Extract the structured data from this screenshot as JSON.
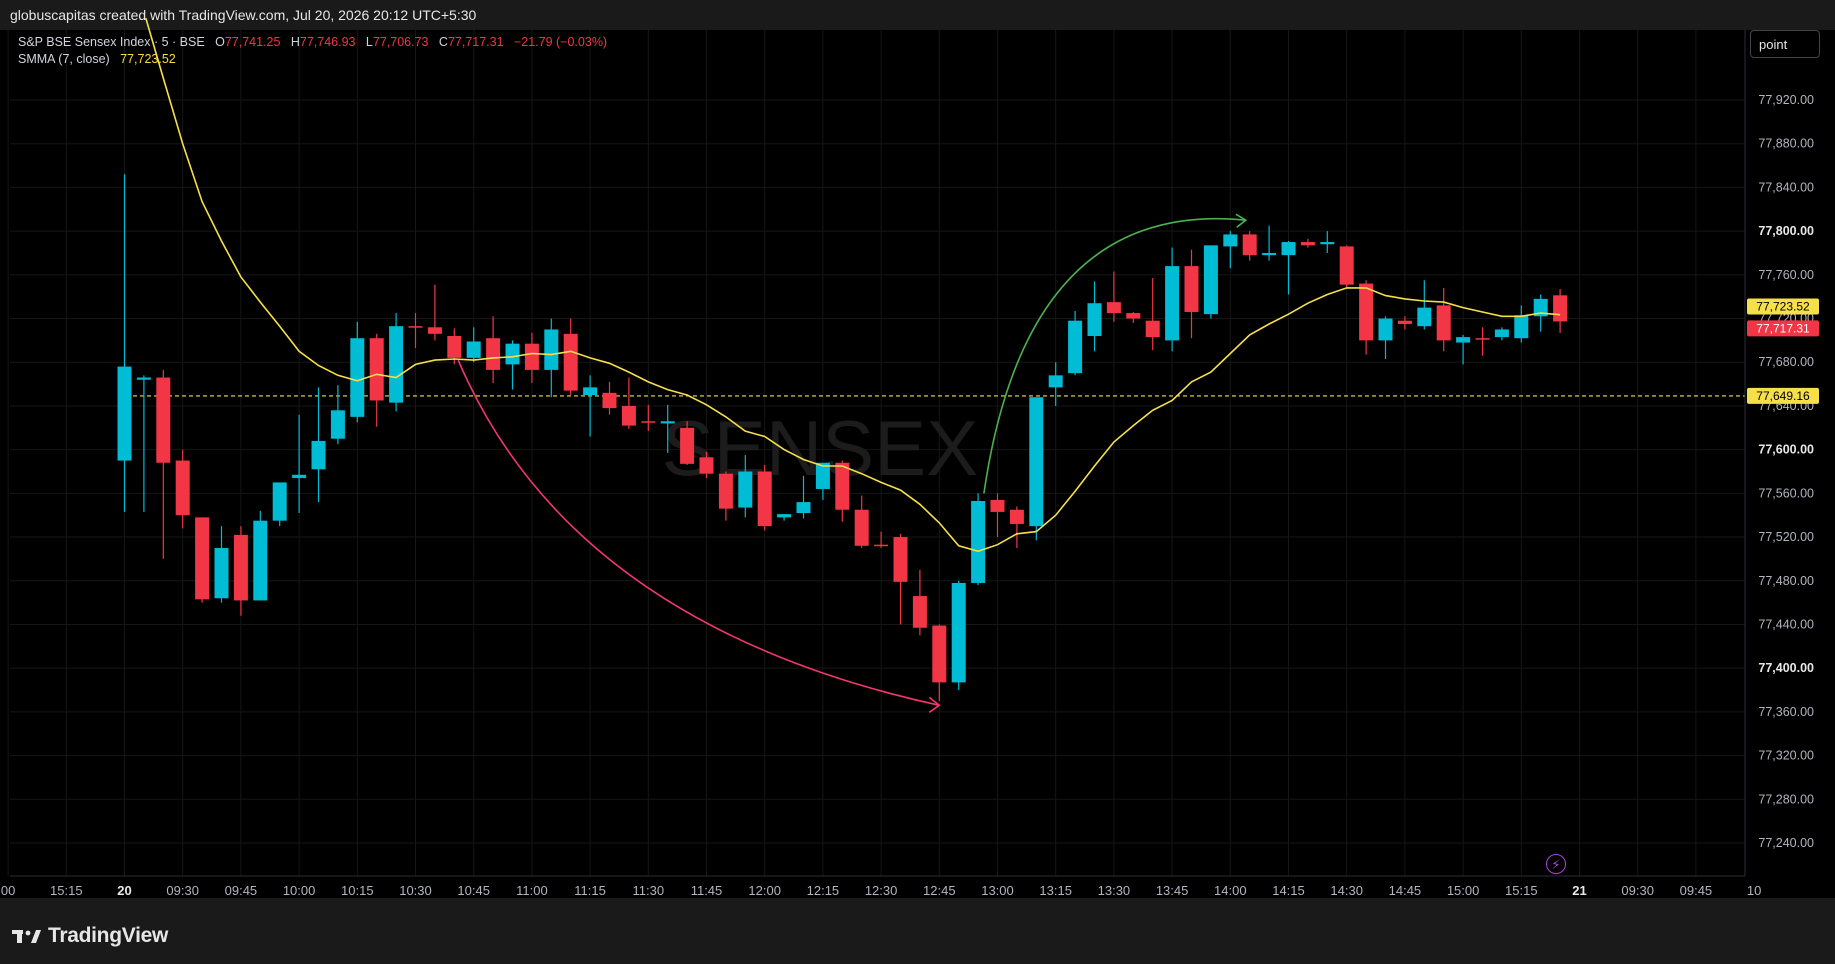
{
  "header": {
    "credit": "globuscapitas created with TradingView.com, Jul 20, 2026 20:12 UTC+5:30"
  },
  "legend": {
    "symbol": "S&P BSE Sensex Index · 5 · BSE",
    "o_label": "O",
    "o_value": "77,741.25",
    "h_label": "H",
    "h_value": "77,746.93",
    "l_label": "L",
    "l_value": "77,706.73",
    "c_label": "C",
    "c_value": "77,717.31",
    "change": "−21.79 (−0.03%)",
    "indicator": "SMMA (7, close)",
    "indicator_value": "77,723.52"
  },
  "toolbar": {
    "point_label": "point"
  },
  "watermark": "SENSEX",
  "brand": {
    "name": "TradingView"
  },
  "price_labels": {
    "smma": "77,723.52",
    "last": "77,717.31",
    "level": "77,649.16"
  },
  "colors": {
    "up": "#00bcd4",
    "down": "#f23645",
    "smma": "#f5e04a",
    "level": "#f5e04a",
    "arrow_down": "#f23670",
    "arrow_up": "#4caf50"
  },
  "chart_data": {
    "type": "candlestick",
    "interval": "5",
    "ylim": [
      77200,
      77960
    ],
    "y_ticks": [
      77240,
      77280,
      77320,
      77360,
      77400,
      77440,
      77480,
      77520,
      77560,
      77600,
      77640,
      77680,
      77720,
      77760,
      77800,
      77840,
      77880,
      77920
    ],
    "y_tick_labels": [
      "77,240.00",
      "77,280.00",
      "77,320.00",
      "77,360.00",
      "77,400.00",
      "77,440.00",
      "77,480.00",
      "77,520.00",
      "77,560.00",
      "77,600.00",
      "77,640.00",
      "77,680.00",
      "77,720.00",
      "77,760.00",
      "77,800.00",
      "77,840.00",
      "77,880.00",
      "77,920.00"
    ],
    "x_ticks": [
      {
        "slot": -6,
        "label": "00"
      },
      {
        "slot": -3,
        "label": "15:15"
      },
      {
        "slot": 0,
        "label": "20"
      },
      {
        "slot": 3,
        "label": "09:30"
      },
      {
        "slot": 6,
        "label": "09:45"
      },
      {
        "slot": 9,
        "label": "10:00"
      },
      {
        "slot": 12,
        "label": "10:15"
      },
      {
        "slot": 15,
        "label": "10:30"
      },
      {
        "slot": 18,
        "label": "10:45"
      },
      {
        "slot": 21,
        "label": "11:00"
      },
      {
        "slot": 24,
        "label": "11:15"
      },
      {
        "slot": 27,
        "label": "11:30"
      },
      {
        "slot": 30,
        "label": "11:45"
      },
      {
        "slot": 33,
        "label": "12:00"
      },
      {
        "slot": 36,
        "label": "12:15"
      },
      {
        "slot": 39,
        "label": "12:30"
      },
      {
        "slot": 42,
        "label": "12:45"
      },
      {
        "slot": 45,
        "label": "13:00"
      },
      {
        "slot": 48,
        "label": "13:15"
      },
      {
        "slot": 51,
        "label": "13:30"
      },
      {
        "slot": 54,
        "label": "13:45"
      },
      {
        "slot": 57,
        "label": "14:00"
      },
      {
        "slot": 60,
        "label": "14:15"
      },
      {
        "slot": 63,
        "label": "14:30"
      },
      {
        "slot": 66,
        "label": "14:45"
      },
      {
        "slot": 69,
        "label": "15:00"
      },
      {
        "slot": 72,
        "label": "15:15"
      },
      {
        "slot": 75,
        "label": "21"
      },
      {
        "slot": 78,
        "label": "09:30"
      },
      {
        "slot": 81,
        "label": "09:45"
      },
      {
        "slot": 84,
        "label": "10"
      }
    ],
    "candles": [
      {
        "o": 77590,
        "h": 77852,
        "l": 77543,
        "c": 77676
      },
      {
        "o": 77664,
        "h": 77668,
        "l": 77543,
        "c": 77666
      },
      {
        "o": 77666,
        "h": 77673,
        "l": 77500,
        "c": 77588
      },
      {
        "o": 77590,
        "h": 77600,
        "l": 77528,
        "c": 77540
      },
      {
        "o": 77538,
        "h": 77538,
        "l": 77460,
        "c": 77463
      },
      {
        "o": 77464,
        "h": 77530,
        "l": 77460,
        "c": 77510
      },
      {
        "o": 77522,
        "h": 77530,
        "l": 77448,
        "c": 77462
      },
      {
        "o": 77462,
        "h": 77544,
        "l": 77462,
        "c": 77535
      },
      {
        "o": 77535,
        "h": 77565,
        "l": 77530,
        "c": 77570
      },
      {
        "o": 77574,
        "h": 77632,
        "l": 77542,
        "c": 77577
      },
      {
        "o": 77582,
        "h": 77657,
        "l": 77552,
        "c": 77608
      },
      {
        "o": 77610,
        "h": 77659,
        "l": 77605,
        "c": 77636
      },
      {
        "o": 77630,
        "h": 77717,
        "l": 77625,
        "c": 77702
      },
      {
        "o": 77702,
        "h": 77706,
        "l": 77621,
        "c": 77645
      },
      {
        "o": 77643,
        "h": 77725,
        "l": 77635,
        "c": 77713
      },
      {
        "o": 77713,
        "h": 77725,
        "l": 77693,
        "c": 77712
      },
      {
        "o": 77712,
        "h": 77751,
        "l": 77700,
        "c": 77706
      },
      {
        "o": 77704,
        "h": 77711,
        "l": 77678,
        "c": 77684
      },
      {
        "o": 77684,
        "h": 77712,
        "l": 77680,
        "c": 77699
      },
      {
        "o": 77702,
        "h": 77722,
        "l": 77661,
        "c": 77673
      },
      {
        "o": 77678,
        "h": 77700,
        "l": 77655,
        "c": 77697
      },
      {
        "o": 77697,
        "h": 77707,
        "l": 77661,
        "c": 77673
      },
      {
        "o": 77673,
        "h": 77720,
        "l": 77648,
        "c": 77710
      },
      {
        "o": 77706,
        "h": 77720,
        "l": 77650,
        "c": 77654
      },
      {
        "o": 77650,
        "h": 77668,
        "l": 77612,
        "c": 77657
      },
      {
        "o": 77652,
        "h": 77662,
        "l": 77632,
        "c": 77638
      },
      {
        "o": 77640,
        "h": 77666,
        "l": 77619,
        "c": 77622
      },
      {
        "o": 77626,
        "h": 77641,
        "l": 77617,
        "c": 77625
      },
      {
        "o": 77624,
        "h": 77641,
        "l": 77597,
        "c": 77626
      },
      {
        "o": 77620,
        "h": 77626,
        "l": 77586,
        "c": 77587
      },
      {
        "o": 77593,
        "h": 77598,
        "l": 77574,
        "c": 77578
      },
      {
        "o": 77578,
        "h": 77580,
        "l": 77535,
        "c": 77546
      },
      {
        "o": 77547,
        "h": 77595,
        "l": 77538,
        "c": 77580
      },
      {
        "o": 77580,
        "h": 77586,
        "l": 77526,
        "c": 77530
      },
      {
        "o": 77538,
        "h": 77541,
        "l": 77535,
        "c": 77541
      },
      {
        "o": 77542,
        "h": 77576,
        "l": 77537,
        "c": 77552
      },
      {
        "o": 77564,
        "h": 77580,
        "l": 77554,
        "c": 77588
      },
      {
        "o": 77588,
        "h": 77590,
        "l": 77534,
        "c": 77545
      },
      {
        "o": 77545,
        "h": 77558,
        "l": 77510,
        "c": 77512
      },
      {
        "o": 77513,
        "h": 77525,
        "l": 77510,
        "c": 77512
      },
      {
        "o": 77520,
        "h": 77523,
        "l": 77440,
        "c": 77479
      },
      {
        "o": 77466,
        "h": 77490,
        "l": 77430,
        "c": 77437
      },
      {
        "o": 77439,
        "h": 77440,
        "l": 77370,
        "c": 77387
      },
      {
        "o": 77387,
        "h": 77480,
        "l": 77380,
        "c": 77478
      },
      {
        "o": 77478,
        "h": 77560,
        "l": 77476,
        "c": 77553
      },
      {
        "o": 77554,
        "h": 77560,
        "l": 77520,
        "c": 77543
      },
      {
        "o": 77545,
        "h": 77548,
        "l": 77510,
        "c": 77532
      },
      {
        "o": 77530,
        "h": 77550,
        "l": 77517,
        "c": 77648
      },
      {
        "o": 77657,
        "h": 77680,
        "l": 77640,
        "c": 77668
      },
      {
        "o": 77670,
        "h": 77727,
        "l": 77668,
        "c": 77718
      },
      {
        "o": 77704,
        "h": 77754,
        "l": 77690,
        "c": 77734
      },
      {
        "o": 77735,
        "h": 77763,
        "l": 77717,
        "c": 77725
      },
      {
        "o": 77725,
        "h": 77726,
        "l": 77716,
        "c": 77720
      },
      {
        "o": 77718,
        "h": 77757,
        "l": 77691,
        "c": 77703
      },
      {
        "o": 77700,
        "h": 77785,
        "l": 77690,
        "c": 77768
      },
      {
        "o": 77768,
        "h": 77783,
        "l": 77702,
        "c": 77726
      },
      {
        "o": 77724,
        "h": 77785,
        "l": 77720,
        "c": 77787
      },
      {
        "o": 77786,
        "h": 77800,
        "l": 77766,
        "c": 77797
      },
      {
        "o": 77797,
        "h": 77800,
        "l": 77773,
        "c": 77778
      },
      {
        "o": 77778,
        "h": 77805,
        "l": 77773,
        "c": 77780
      },
      {
        "o": 77778,
        "h": 77791,
        "l": 77742,
        "c": 77790
      },
      {
        "o": 77790,
        "h": 77793,
        "l": 77785,
        "c": 77787
      },
      {
        "o": 77788,
        "h": 77800,
        "l": 77780,
        "c": 77790
      },
      {
        "o": 77786,
        "h": 77787,
        "l": 77748,
        "c": 77751
      },
      {
        "o": 77752,
        "h": 77755,
        "l": 77687,
        "c": 77700
      },
      {
        "o": 77700,
        "h": 77722,
        "l": 77683,
        "c": 77720
      },
      {
        "o": 77718,
        "h": 77722,
        "l": 77710,
        "c": 77715
      },
      {
        "o": 77713,
        "h": 77755,
        "l": 77710,
        "c": 77730
      },
      {
        "o": 77732,
        "h": 77748,
        "l": 77690,
        "c": 77700
      },
      {
        "o": 77698,
        "h": 77705,
        "l": 77678,
        "c": 77703
      },
      {
        "o": 77702,
        "h": 77712,
        "l": 77686,
        "c": 77701
      },
      {
        "o": 77703,
        "h": 77712,
        "l": 77700,
        "c": 77710
      },
      {
        "o": 77702,
        "h": 77732,
        "l": 77698,
        "c": 77723
      },
      {
        "o": 77722,
        "h": 77742,
        "l": 77708,
        "c": 77738
      },
      {
        "o": 77741.25,
        "h": 77746.93,
        "l": 77706.73,
        "c": 77717.31
      }
    ],
    "smma": {
      "name": "SMMA (7, close)",
      "points": [
        {
          "slot": 1.1,
          "v": 77995
        },
        {
          "slot": 2,
          "v": 77940
        },
        {
          "slot": 3,
          "v": 77880
        },
        {
          "slot": 4,
          "v": 77827
        },
        {
          "slot": 5,
          "v": 77791
        },
        {
          "slot": 6,
          "v": 77758
        },
        {
          "slot": 7,
          "v": 77735
        },
        {
          "slot": 8,
          "v": 77713
        },
        {
          "slot": 9,
          "v": 77690
        },
        {
          "slot": 10,
          "v": 77677
        },
        {
          "slot": 11,
          "v": 77668
        },
        {
          "slot": 12,
          "v": 77663
        },
        {
          "slot": 13,
          "v": 77669
        },
        {
          "slot": 14,
          "v": 77666
        },
        {
          "slot": 15,
          "v": 77678
        },
        {
          "slot": 16,
          "v": 77682
        },
        {
          "slot": 17,
          "v": 77683
        },
        {
          "slot": 18,
          "v": 77682
        },
        {
          "slot": 19,
          "v": 77684
        },
        {
          "slot": 20,
          "v": 77685
        },
        {
          "slot": 21,
          "v": 77688
        },
        {
          "slot": 22,
          "v": 77687
        },
        {
          "slot": 23,
          "v": 77690
        },
        {
          "slot": 24,
          "v": 77684
        },
        {
          "slot": 25,
          "v": 77679
        },
        {
          "slot": 26,
          "v": 77671
        },
        {
          "slot": 27,
          "v": 77662
        },
        {
          "slot": 28,
          "v": 77655
        },
        {
          "slot": 29,
          "v": 77650
        },
        {
          "slot": 30,
          "v": 77641
        },
        {
          "slot": 31,
          "v": 77630
        },
        {
          "slot": 32,
          "v": 77617
        },
        {
          "slot": 33,
          "v": 77612
        },
        {
          "slot": 34,
          "v": 77600
        },
        {
          "slot": 35,
          "v": 77591
        },
        {
          "slot": 36,
          "v": 77585
        },
        {
          "slot": 37,
          "v": 77585
        },
        {
          "slot": 38,
          "v": 77578
        },
        {
          "slot": 39,
          "v": 77570
        },
        {
          "slot": 40,
          "v": 77563
        },
        {
          "slot": 41,
          "v": 77550
        },
        {
          "slot": 42,
          "v": 77533
        },
        {
          "slot": 43,
          "v": 77512
        },
        {
          "slot": 44,
          "v": 77507
        },
        {
          "slot": 45,
          "v": 77513
        },
        {
          "slot": 46,
          "v": 77523
        },
        {
          "slot": 47,
          "v": 77525
        },
        {
          "slot": 48,
          "v": 77540
        },
        {
          "slot": 49,
          "v": 77562
        },
        {
          "slot": 50,
          "v": 77585
        },
        {
          "slot": 51,
          "v": 77607
        },
        {
          "slot": 52,
          "v": 77622
        },
        {
          "slot": 53,
          "v": 77636
        },
        {
          "slot": 54,
          "v": 77645
        },
        {
          "slot": 55,
          "v": 77662
        },
        {
          "slot": 56,
          "v": 77671
        },
        {
          "slot": 57,
          "v": 77688
        },
        {
          "slot": 58,
          "v": 77705
        },
        {
          "slot": 59,
          "v": 77715
        },
        {
          "slot": 60,
          "v": 77724
        },
        {
          "slot": 61,
          "v": 77734
        },
        {
          "slot": 62,
          "v": 77742
        },
        {
          "slot": 63,
          "v": 77748
        },
        {
          "slot": 64,
          "v": 77748
        },
        {
          "slot": 65,
          "v": 77741
        },
        {
          "slot": 66,
          "v": 77738
        },
        {
          "slot": 67,
          "v": 77736
        },
        {
          "slot": 68,
          "v": 77735
        },
        {
          "slot": 69,
          "v": 77730
        },
        {
          "slot": 70,
          "v": 77726
        },
        {
          "slot": 71,
          "v": 77722
        },
        {
          "slot": 72,
          "v": 77722
        },
        {
          "slot": 73,
          "v": 77725
        },
        {
          "slot": 74,
          "v": 77723.52
        }
      ]
    },
    "level": 77649.16,
    "watermark": "SENSEX"
  }
}
